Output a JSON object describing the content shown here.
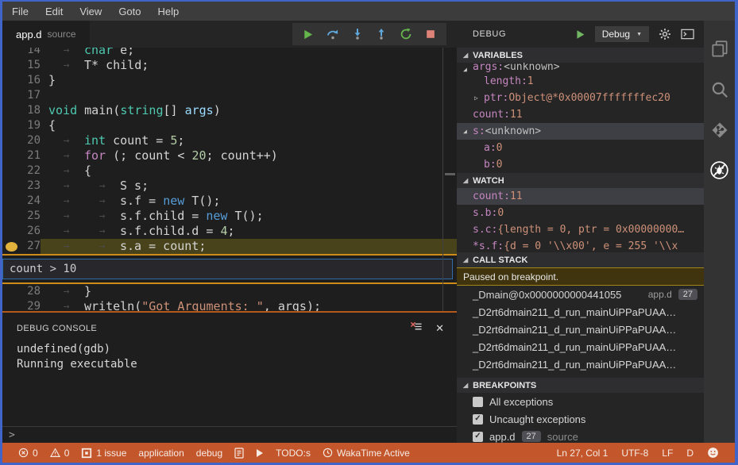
{
  "menu_bar": {
    "items": [
      "File",
      "Edit",
      "View",
      "Goto",
      "Help"
    ]
  },
  "editor": {
    "tab": {
      "name": "app.d",
      "hint": "source"
    },
    "toolbar_buttons": [
      {
        "name": "continue-button",
        "icon": "continue-icon"
      },
      {
        "name": "step-over-button",
        "icon": "step-over-icon"
      },
      {
        "name": "step-into-button",
        "icon": "step-into-icon"
      },
      {
        "name": "step-out-button",
        "icon": "step-out-icon"
      },
      {
        "name": "restart-button",
        "icon": "restart-icon"
      },
      {
        "name": "stop-button",
        "icon": "stop-icon"
      }
    ],
    "breakpoint_condition": "count > 10",
    "code_lines": [
      {
        "num": 14,
        "indent": 1,
        "tokens": [
          {
            "t": "char",
            "c": "type"
          },
          {
            "t": " e;",
            "c": "plain"
          }
        ]
      },
      {
        "num": 15,
        "indent": 1,
        "tokens": [
          {
            "t": "T* child;",
            "c": "plain"
          }
        ]
      },
      {
        "num": 16,
        "indent": 0,
        "tokens": [
          {
            "t": "}",
            "c": "plain"
          }
        ]
      },
      {
        "num": 17,
        "indent": 0,
        "tokens": []
      },
      {
        "num": 18,
        "indent": 0,
        "tokens": [
          {
            "t": "void",
            "c": "type"
          },
          {
            "t": " main(",
            "c": "plain"
          },
          {
            "t": "string",
            "c": "type"
          },
          {
            "t": "[] ",
            "c": "plain"
          },
          {
            "t": "args",
            "c": "param"
          },
          {
            "t": ")",
            "c": "plain"
          }
        ]
      },
      {
        "num": 19,
        "indent": 0,
        "tokens": [
          {
            "t": "{",
            "c": "plain"
          }
        ]
      },
      {
        "num": 20,
        "indent": 1,
        "tokens": [
          {
            "t": "int",
            "c": "type"
          },
          {
            "t": " count = ",
            "c": "plain"
          },
          {
            "t": "5",
            "c": "number"
          },
          {
            "t": ";",
            "c": "plain"
          }
        ]
      },
      {
        "num": 21,
        "indent": 1,
        "tokens": [
          {
            "t": "for",
            "c": "keyword"
          },
          {
            "t": " (; count < ",
            "c": "plain"
          },
          {
            "t": "20",
            "c": "number"
          },
          {
            "t": "; count++)",
            "c": "plain"
          }
        ]
      },
      {
        "num": 22,
        "indent": 1,
        "tokens": [
          {
            "t": "{",
            "c": "plain"
          }
        ]
      },
      {
        "num": 23,
        "indent": 2,
        "tokens": [
          {
            "t": "S s;",
            "c": "plain"
          }
        ]
      },
      {
        "num": 24,
        "indent": 2,
        "tokens": [
          {
            "t": "s.f = ",
            "c": "plain"
          },
          {
            "t": "new",
            "c": "keyword2"
          },
          {
            "t": " T();",
            "c": "plain"
          }
        ]
      },
      {
        "num": 25,
        "indent": 2,
        "tokens": [
          {
            "t": "s.f.child = ",
            "c": "plain"
          },
          {
            "t": "new",
            "c": "keyword2"
          },
          {
            "t": " T();",
            "c": "plain"
          }
        ]
      },
      {
        "num": 26,
        "indent": 2,
        "tokens": [
          {
            "t": "s.f.child.d = ",
            "c": "plain"
          },
          {
            "t": "4",
            "c": "number"
          },
          {
            "t": ";",
            "c": "plain"
          }
        ]
      },
      {
        "num": 27,
        "indent": 2,
        "current": true,
        "breakpoint": true,
        "tokens": [
          {
            "t": "s.a = count;",
            "c": "plain"
          }
        ]
      },
      {
        "num": 28,
        "indent": 1,
        "tokens": [
          {
            "t": "}",
            "c": "plain"
          }
        ]
      },
      {
        "num": 29,
        "indent": 1,
        "tokens": [
          {
            "t": "writeln(",
            "c": "plain"
          },
          {
            "t": "\"Got Arguments: \"",
            "c": "string"
          },
          {
            "t": ", args);",
            "c": "plain"
          }
        ]
      }
    ]
  },
  "debug_console": {
    "title": "DEBUG CONSOLE",
    "output_lines": [
      "undefined(gdb)",
      "Running executable"
    ],
    "prompt": ">"
  },
  "debug_sidebar": {
    "title": "DEBUG",
    "config_dropdown": "Debug",
    "sections": {
      "variables": {
        "title": "VARIABLES",
        "rows": [
          {
            "key": "args",
            "value": "<unknown>",
            "twisty": "open",
            "indent": 0,
            "clip_top": true
          },
          {
            "key": "length",
            "value": "1",
            "indent": 1
          },
          {
            "key": "ptr",
            "value": "Object@*0x00007fffffffec20",
            "twisty": "closed",
            "indent": 1
          },
          {
            "key": "count",
            "value": "11",
            "indent": 0
          },
          {
            "key": "s",
            "value": "<unknown>",
            "twisty": "open",
            "indent": 0,
            "selected": true
          },
          {
            "key": "a",
            "value": "0",
            "indent": 1
          },
          {
            "key": "b",
            "value": "0",
            "indent": 1
          }
        ]
      },
      "watch": {
        "title": "WATCH",
        "rows": [
          {
            "key": "count",
            "value": "11",
            "selected": true
          },
          {
            "key": "s.b",
            "value": "0"
          },
          {
            "key": "s.c",
            "value": "{length = 0, ptr = 0x00000000…"
          },
          {
            "key": "*s.f",
            "value": "{d = 0 '\\\\x00', e = 255 '\\\\x",
            "clip_bottom": true
          }
        ]
      },
      "call_stack": {
        "title": "CALL STACK",
        "status_message": "Paused on breakpoint.",
        "frames": [
          {
            "name": "_Dmain@0x0000000000441055",
            "file": "app.d",
            "line": "27"
          },
          {
            "name": "_D2rt6dmain211_d_run_mainUiPPaPUAA…"
          },
          {
            "name": "_D2rt6dmain211_d_run_mainUiPPaPUAA…"
          },
          {
            "name": "_D2rt6dmain211_d_run_mainUiPPaPUAA…"
          },
          {
            "name": "_D2rt6dmain211_d_run_mainUiPPaPUAA…"
          }
        ]
      },
      "breakpoints": {
        "title": "BREAKPOINTS",
        "items": [
          {
            "checked": false,
            "label": "All exceptions"
          },
          {
            "checked": true,
            "label": "Uncaught exceptions"
          },
          {
            "checked": true,
            "label": "app.d",
            "line_badge": "27",
            "hint": "source"
          }
        ]
      }
    }
  },
  "activity_bar": {
    "items": [
      {
        "name": "explorer",
        "icon": "files-icon",
        "active": false
      },
      {
        "name": "search",
        "icon": "search-icon",
        "active": false
      },
      {
        "name": "source-control",
        "icon": "source-control-icon",
        "active": false
      },
      {
        "name": "debug",
        "icon": "debug-icon",
        "active": true
      }
    ]
  },
  "status_bar": {
    "left": [
      {
        "name": "errors",
        "icon": "error-icon",
        "label": "0"
      },
      {
        "name": "warnings",
        "icon": "warning-icon",
        "label": "0"
      },
      {
        "name": "issues",
        "icon": "issues-icon",
        "label": "1 issue"
      },
      {
        "name": "task-application",
        "label": "application"
      },
      {
        "name": "task-debug",
        "label": "debug"
      },
      {
        "name": "output",
        "icon": "output-icon"
      },
      {
        "name": "run",
        "icon": "run-icon"
      },
      {
        "name": "todos",
        "label": "TODO:s"
      },
      {
        "name": "wakatime",
        "icon": "clock-icon",
        "label": "WakaTime Active"
      }
    ],
    "right": [
      {
        "name": "cursor-position",
        "label": "Ln 27, Col 1"
      },
      {
        "name": "encoding",
        "label": "UTF-8"
      },
      {
        "name": "eol",
        "label": "LF"
      },
      {
        "name": "language-mode",
        "label": "D"
      },
      {
        "name": "feedback",
        "icon": "feedback-icon"
      }
    ]
  },
  "colors": {
    "window_border": "#4164C8",
    "status_bar_bg": "#C4562C",
    "current_line_bg": "#49431B",
    "condition_widget_border": "#CE8C1B",
    "panel_top_border": "#B4591C",
    "breakpoint_dot": "#E2B33C",
    "paused_message_bg": "#3F340D",
    "paused_message_border": "#A1861B",
    "token_type": "#4EC9B0",
    "token_keyword": "#C586C0",
    "token_new": "#569CD6",
    "token_number": "#B5CEA8",
    "token_string": "#CE9178",
    "variable_key": "#C586C0",
    "variable_value": "#CE9178"
  }
}
